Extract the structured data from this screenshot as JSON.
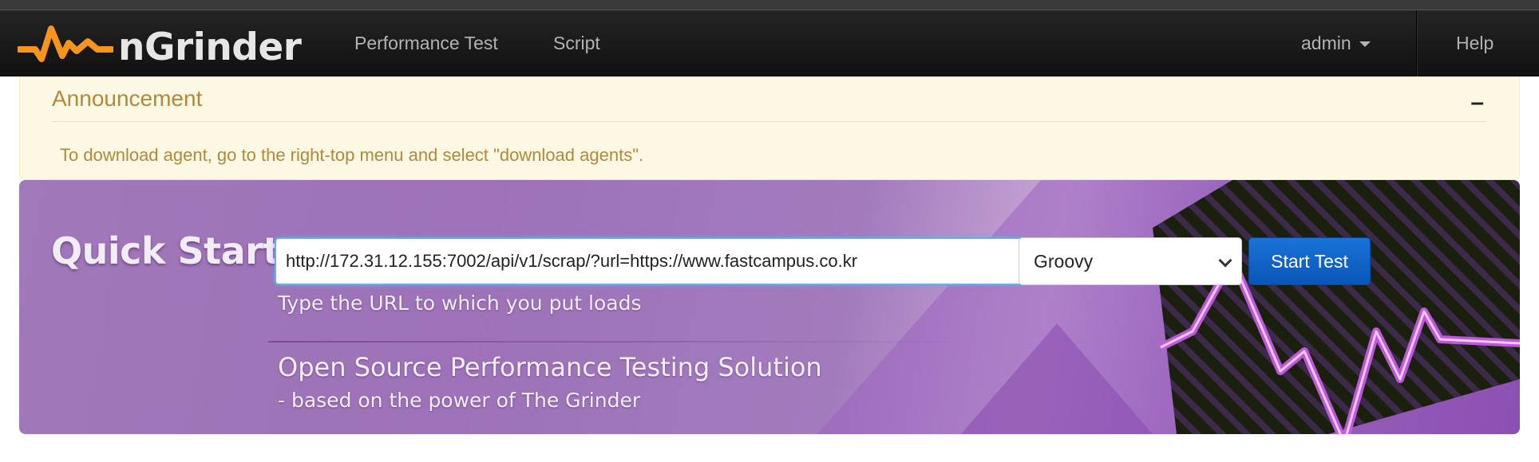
{
  "brand": {
    "name": "nGrinder",
    "logo_icon": "waveform-logo-icon",
    "logo_color": "#f7941d"
  },
  "nav": {
    "items": [
      {
        "label": "Performance Test"
      },
      {
        "label": "Script"
      }
    ],
    "user": {
      "label": "admin",
      "icon": "caret-down-icon"
    },
    "help": {
      "label": "Help"
    }
  },
  "announcement": {
    "title": "Announcement",
    "collapse_label": "–",
    "message": "To download agent, go to the right-top menu and select \"download agents\"."
  },
  "quick_start": {
    "title": "Quick Start",
    "url_value": "http://172.31.12.155:7002/api/v1/scrap/?url=https://www.fastcampus.co.kr",
    "hint": "Type the URL to which you put loads",
    "script_type": {
      "selected": "Groovy"
    },
    "start_button": "Start Test",
    "tagline": "Open Source Performance Testing Solution",
    "subtagline": "- based on the power of The Grinder"
  },
  "colors": {
    "navbar_bg": "#1b1b1b",
    "alert_bg": "#fcf8e3",
    "alert_text": "#b0893a",
    "hero_purple": "#a079b9",
    "accent_blue": "#0a63c9"
  }
}
